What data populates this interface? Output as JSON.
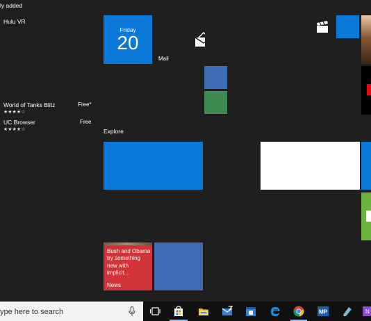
{
  "start_menu": {
    "recently_added_header": "ly added",
    "apps": [
      {
        "name": "Hulu VR"
      }
    ],
    "suggested": [
      {
        "name": "World of Tanks Blitz",
        "rating": "★★★★☆",
        "price": "Free*"
      },
      {
        "name": "UC Browser",
        "rating": "★★★★☆",
        "price": "Free"
      }
    ]
  },
  "tiles": {
    "calendar": {
      "day": "Friday",
      "date": "20"
    },
    "mail_label": "Mail",
    "explore_label": "Explore",
    "news": {
      "headline": "Bush and Obama try something new with implicit...",
      "label": "News"
    }
  },
  "taskbar": {
    "search_placeholder": "ype here to search"
  },
  "colors": {
    "accent_blue": "#0a78d7",
    "steel_blue": "#3d6cb5",
    "green": "#3f8a52",
    "news_red": "#d13438",
    "lime": "#6ab43e"
  }
}
